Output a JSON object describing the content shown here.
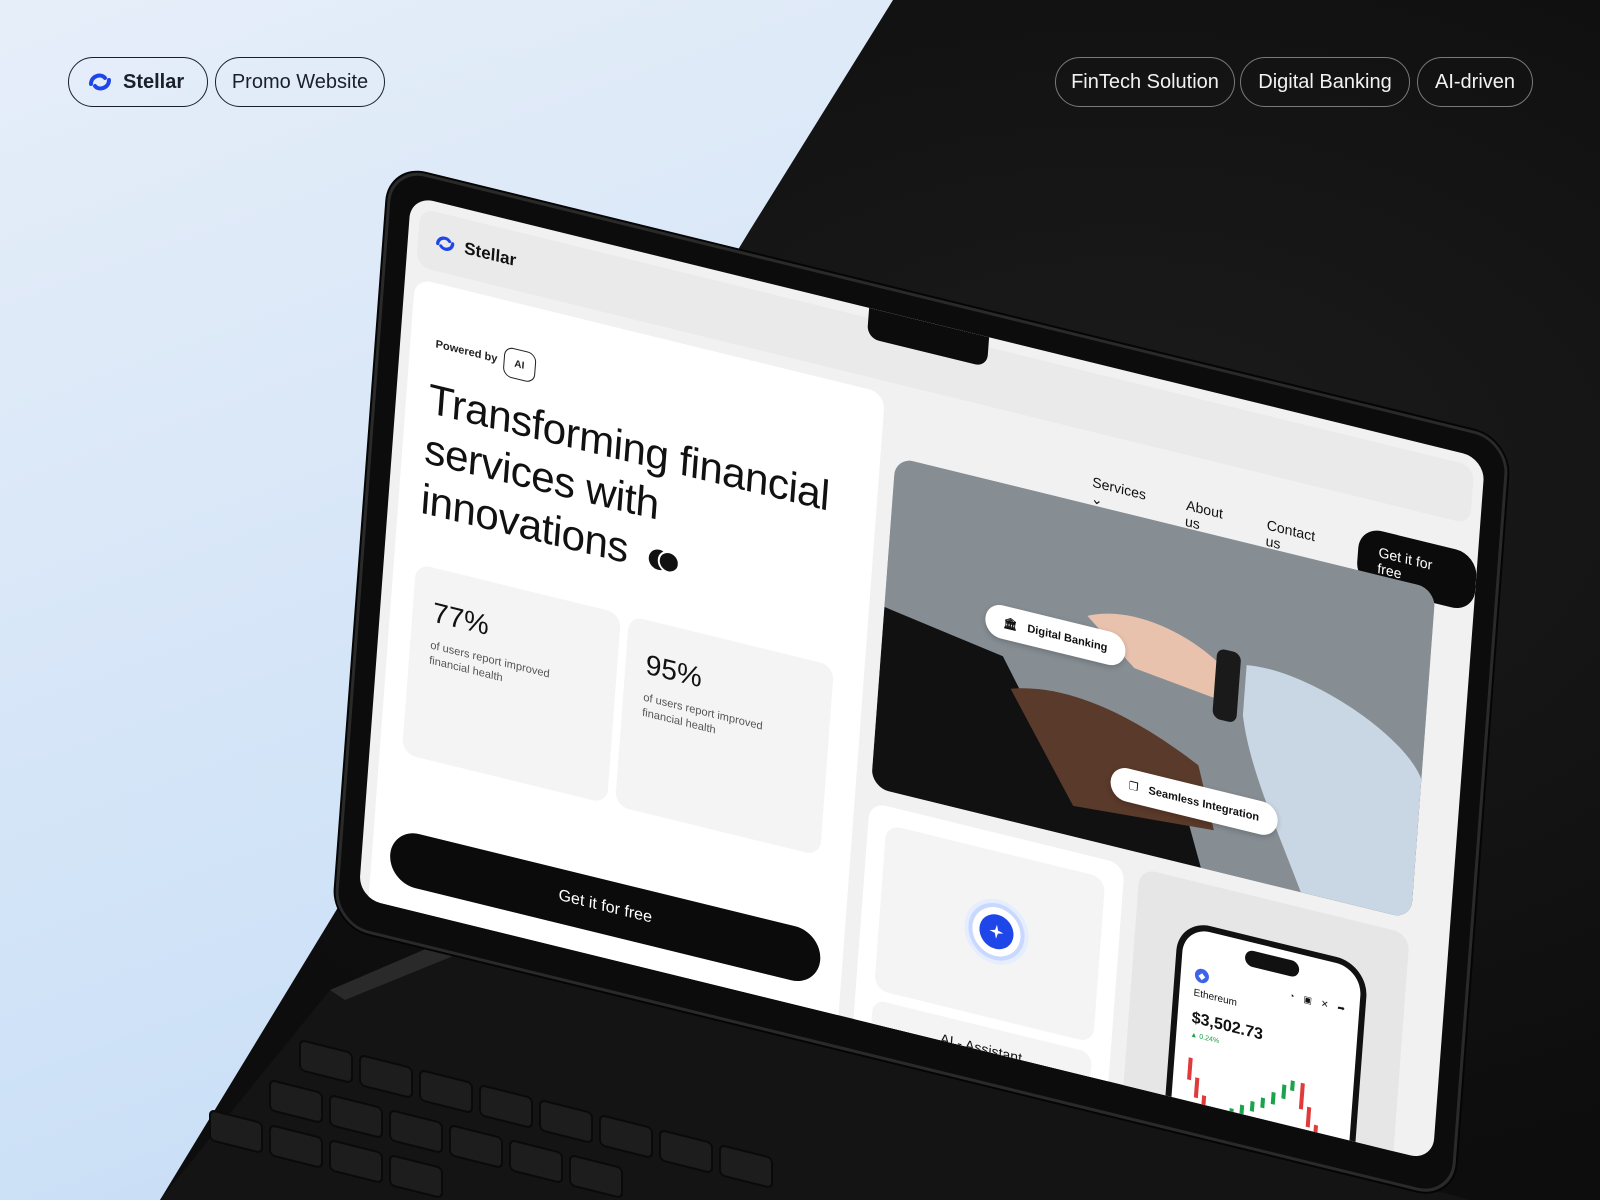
{
  "header": {
    "brand_label": "Stellar",
    "promo_label": "Promo Website",
    "tags": [
      "FinTech Solution",
      "Digital Banking",
      "AI-driven"
    ]
  },
  "site": {
    "brand": "Stellar",
    "powered_by": "Powered by",
    "ai_badge": "AI",
    "headline": "Transforming financial services with innovations",
    "stats": [
      {
        "value": "77%",
        "desc": "of users report improved financial health"
      },
      {
        "value": "95%",
        "desc": "of users report improved financial health"
      }
    ],
    "cta_main": "Get it for free",
    "nav": {
      "services": "Services",
      "about": "About us",
      "contact": "Contact us",
      "cta": "Get it for free"
    },
    "chips": {
      "digital_banking": "Digital Banking",
      "seamless": "Seamless Integration"
    },
    "ai_assistant": "AI - Assistant",
    "phone": {
      "coin": "Ethereum",
      "price": "$3,502.73",
      "change": "▲ 0.24%"
    }
  },
  "colors": {
    "brand_blue": "#1e46e8",
    "dark": "#0b0b0b",
    "light_bg": "#dbe9f9",
    "up_green": "#1aa34a",
    "down_red": "#e03a3a"
  }
}
